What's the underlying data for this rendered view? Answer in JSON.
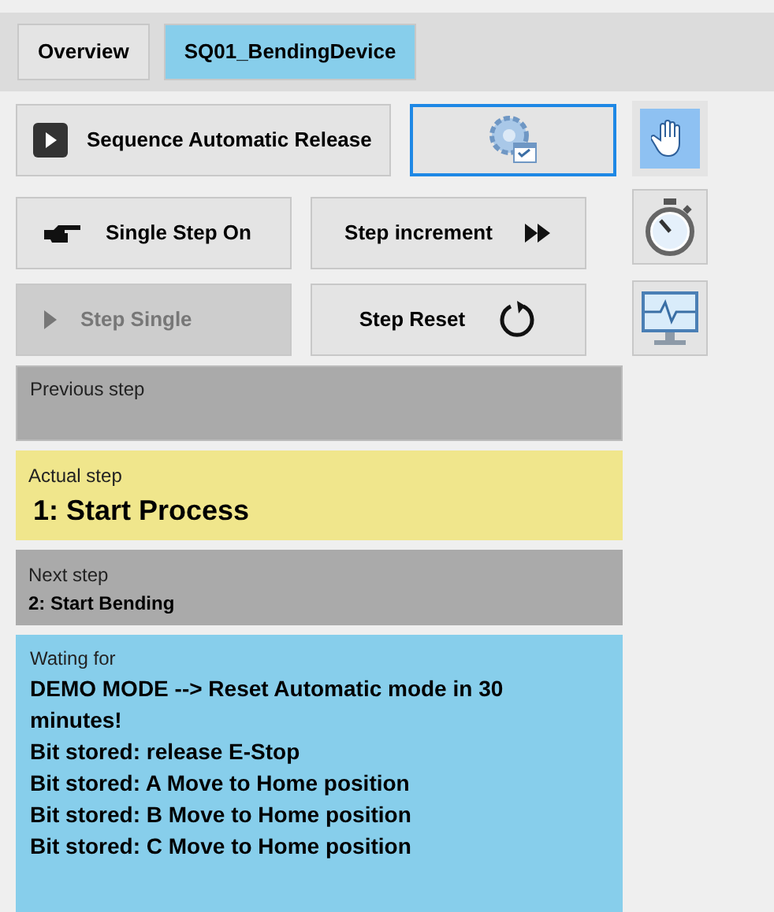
{
  "tabs": [
    {
      "label": "Overview",
      "selected": false
    },
    {
      "label": "SQ01_BendingDevice",
      "selected": true
    }
  ],
  "release_button": {
    "label": "Sequence Automatic Release"
  },
  "config_button": {
    "selected": true
  },
  "manual_button": {
    "selected": true
  },
  "step_buttons": [
    {
      "kind": "single-on",
      "label": "Single Step On",
      "disabled": false
    },
    {
      "kind": "increment",
      "label": "Step increment",
      "disabled": false
    },
    {
      "kind": "single",
      "label": "Step Single",
      "disabled": true
    },
    {
      "kind": "reset",
      "label": "Step Reset",
      "disabled": false
    }
  ],
  "side_buttons": [
    {
      "kind": "stopwatch"
    },
    {
      "kind": "monitor"
    }
  ],
  "previous_step": {
    "label": "Previous step"
  },
  "actual_step": {
    "label": "Actual step",
    "value": "1: Start Process"
  },
  "next_step": {
    "label": "Next step",
    "value": "2: Start Bending"
  },
  "waiting": {
    "label": "Wating for",
    "lines": [
      "DEMO MODE --> Reset Automatic mode in 30 minutes!",
      "Bit stored: release E-Stop",
      "Bit stored: A Move to Home position",
      "Bit stored: B Move to Home position",
      "Bit stored: C Move to Home position"
    ]
  }
}
